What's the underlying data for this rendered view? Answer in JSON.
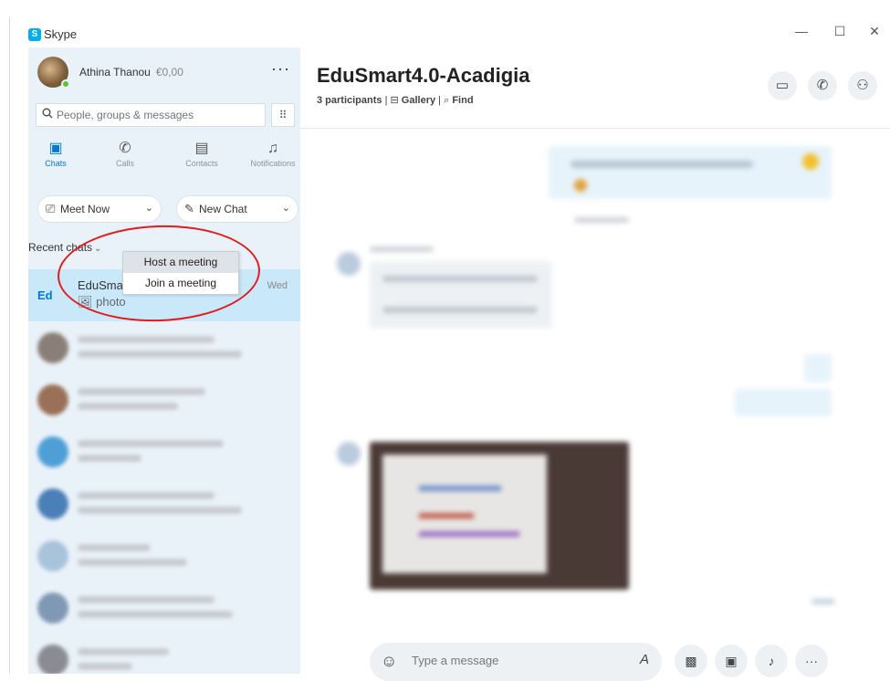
{
  "window": {
    "app_title": "Skype",
    "minimize": "—",
    "maximize": "☐",
    "close": "✕"
  },
  "profile": {
    "name": "Athina Thanou",
    "credit": "€0,00",
    "more": "···"
  },
  "search": {
    "placeholder": "People, groups & messages",
    "icon": "search-icon",
    "dialpad_icon": "⠿"
  },
  "nav": [
    {
      "label": "Chats",
      "icon": "▣"
    },
    {
      "label": "Calls",
      "icon": "✆"
    },
    {
      "label": "Contacts",
      "icon": "▤"
    },
    {
      "label": "Notifications",
      "icon": "♫"
    }
  ],
  "actions": {
    "meet_now": "Meet Now",
    "new_chat": "New Chat",
    "chevron": "⌄"
  },
  "recent": {
    "label": "Recent chats",
    "chevron": "⌄"
  },
  "meet_menu": {
    "items": [
      "Host a meeting",
      "Join a meeting"
    ]
  },
  "chats": [
    {
      "title": "EduSmart4.0-Acadigia",
      "subtitle": "photo",
      "time": "Wed",
      "initials": "Ed",
      "selected": true
    }
  ],
  "conversation": {
    "title": "EduSmart4.0-Acadigia",
    "participants": "3 participants",
    "separator": "|",
    "gallery": "Gallery",
    "find": "Find"
  },
  "header_buttons": [
    {
      "name": "video-call-button",
      "icon": "▭"
    },
    {
      "name": "audio-call-button",
      "icon": "✆"
    },
    {
      "name": "add-people-button",
      "icon": "⚇"
    }
  ],
  "composer": {
    "placeholder": "Type a message",
    "emoji_icon": "☺",
    "format_icon": "A"
  },
  "composer_buttons": [
    {
      "name": "media-button",
      "icon": "▩"
    },
    {
      "name": "contact-card-button",
      "icon": "▣"
    },
    {
      "name": "microphone-button",
      "icon": "♪"
    },
    {
      "name": "more-button",
      "icon": "···"
    }
  ],
  "colors": {
    "accent": "#0078d4",
    "sidebar_bg": "#eaf2f9",
    "selected_row": "#c9e9fb",
    "annotation_circle": "#e21b1b"
  }
}
